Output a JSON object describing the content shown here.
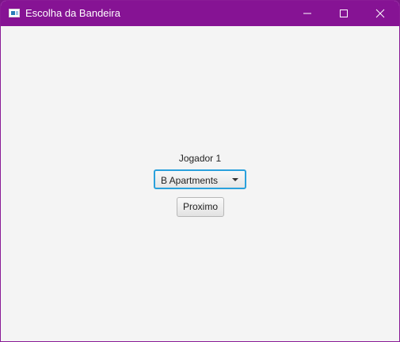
{
  "window": {
    "title": "Escolha da Bandeira",
    "controls": {
      "minimize_icon": "minimize-icon",
      "maximize_icon": "maximize-icon",
      "close_icon": "close-icon"
    },
    "titlebar_color": "#861394"
  },
  "main": {
    "player_label": "Jogador 1",
    "flag_select": {
      "selected": "B Apartments"
    },
    "next_button": "Proximo"
  }
}
